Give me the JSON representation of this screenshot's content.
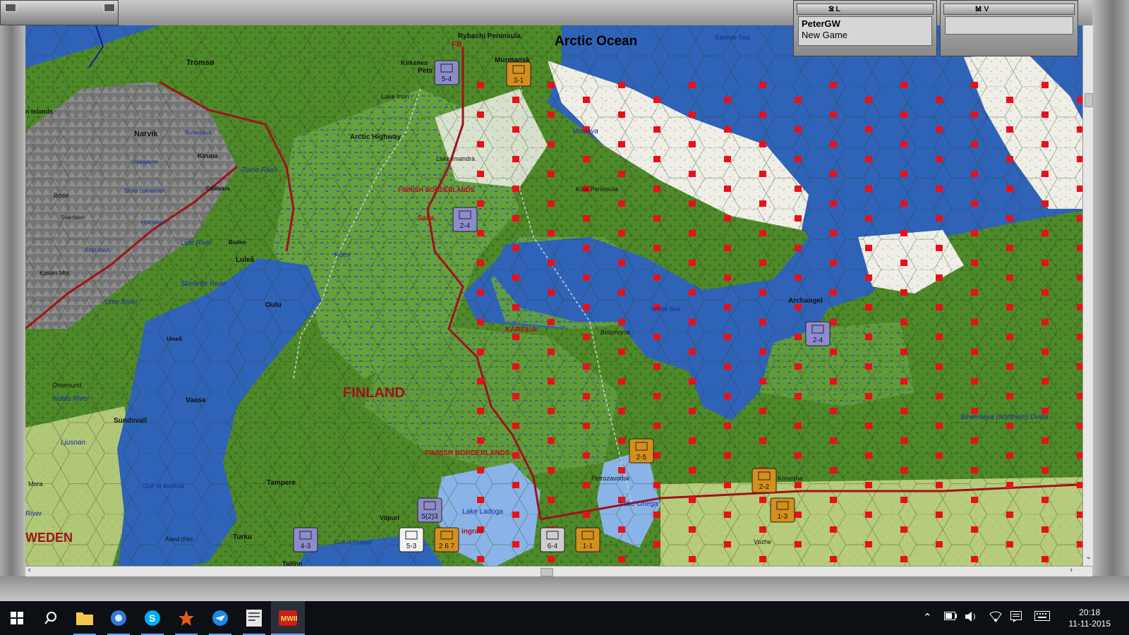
{
  "panels": {
    "sl": {
      "title": "S L",
      "player": "PeterGW",
      "status": "New Game"
    },
    "mv": {
      "title": "M V"
    }
  },
  "map": {
    "labels": {
      "arctic_ocean": "Arctic Ocean",
      "rybachi": "Rybachi Peninsula",
      "fb": "FB",
      "barents": "Barents Sea",
      "murmansk": "Murmansk",
      "kirkenes": "Kirkenes",
      "petsamo": "Pets",
      "tromso": "Tromsø",
      "lake_inari": "Lake Inari",
      "islands": "n Islands",
      "narvik": "Narvik",
      "tornetrask": "Tornetrask",
      "kiruna": "Kiruna",
      "arctic_highway": "Arctic Highway",
      "voronya": "Voronya",
      "akkajaure": "Akkajaure",
      "lake_imandra": "Lake Imandra",
      "torne": "Torne River",
      "bodo": "Bodø",
      "stora": "Stora Lulevatten",
      "gallivare": "Gällivare",
      "finnish_border_n": "FINNISH BORDERLANDS",
      "kola": "Kola Peninsula",
      "svartisen": "Svartisen",
      "salla": "Salla",
      "hornavan": "Hornavan",
      "lule_river": "Lule River",
      "boden": "Boden",
      "storuman": "Storuman",
      "lulea": "Luleå",
      "kemi": "Kemi",
      "kjolen": "Kjølen Mts",
      "skelleft": "Skellefte River",
      "ume_river": "Ume River",
      "oulu": "Oulu",
      "white_sea": "White Sea",
      "archangel": "Archangel",
      "karelia": "KARELIA",
      "belomorsk": "Belomorsk",
      "umea": "Umeå",
      "ostersund": "Östersund",
      "finland": "FINLAND",
      "indals": "Indals River",
      "vaasa": "Vaasa",
      "sundsvall": "Sundsvall",
      "dvina": "Severnaya (Northern) Dvina",
      "ljusnan": "Ljusnan",
      "finnish_border_s": "FINNISH BORDERLANDS",
      "petrozavodsk": "Petrozavodsk",
      "konosha": "Konosha",
      "more": "Mora",
      "tampere": "Tampere",
      "gulf_bothnia": "Gulf of Bothnia",
      "lake_onega": "Lake Onega",
      "lake_ladoga": "Lake Ladoga",
      "river": "River",
      "viipuri": "Viipuri",
      "sweden": "WEDEN",
      "aland": "Åland (Fin)",
      "turku": "Turku",
      "gulf_finland": "Gulf of Finland",
      "leningrad": "ingrad",
      "vozhe": "Vozhe",
      "tallinn": "Tallinn"
    },
    "units": [
      {
        "id": "u1",
        "text": "5-4",
        "kind": "air",
        "color": "#8c8ccc"
      },
      {
        "id": "u2",
        "text": "3-1",
        "kind": "armor",
        "color": "#d4901c"
      },
      {
        "id": "u3",
        "text": "2-4",
        "kind": "air",
        "color": "#8c8ccc"
      },
      {
        "id": "u4",
        "text": "2-4",
        "kind": "air",
        "color": "#8c8ccc"
      },
      {
        "id": "u5",
        "text": "2-5",
        "kind": "armor",
        "color": "#d4901c"
      },
      {
        "id": "u6",
        "text": "2-2",
        "kind": "armor",
        "color": "#d4901c"
      },
      {
        "id": "u7",
        "text": "1-3",
        "kind": "armor",
        "color": "#d4901c"
      },
      {
        "id": "u8",
        "text": "5(2)3",
        "kind": "air",
        "color": "#8c8ccc"
      },
      {
        "id": "u9",
        "text": "4-3",
        "kind": "air",
        "color": "#8c8ccc"
      },
      {
        "id": "u10",
        "text": "5-3",
        "kind": "inf",
        "color": "#f2f2f2"
      },
      {
        "id": "u11",
        "text": "2 6 7",
        "kind": "stack",
        "color": "#d4901c"
      },
      {
        "id": "u12",
        "text": "6-4",
        "kind": "inf",
        "color": "#cfcfcf"
      },
      {
        "id": "u13",
        "text": "1-1",
        "kind": "armor",
        "color": "#d4901c"
      }
    ]
  },
  "taskbar": {
    "time": "20:18",
    "date": "11-11-2015"
  }
}
